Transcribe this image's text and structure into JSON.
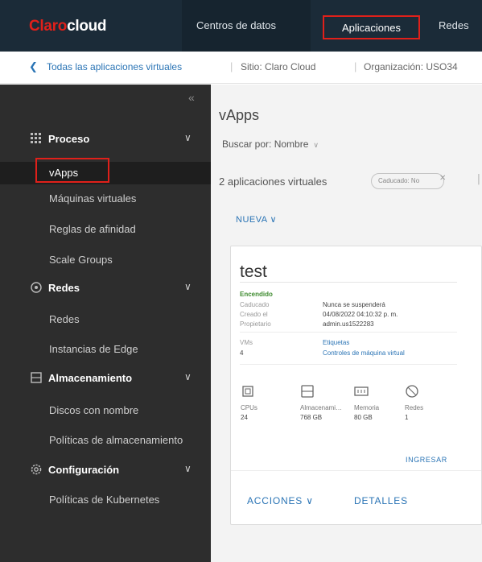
{
  "header": {
    "logo_brand": "Claro",
    "logo_product": "cloud",
    "tabs": [
      {
        "label": "Centros de datos"
      },
      {
        "label": "Aplicaciones"
      },
      {
        "label": "Redes"
      }
    ]
  },
  "breadcrumb": {
    "back_icon": "chevron-left-icon",
    "link": "Todas las aplicaciones virtuales",
    "site": "Sitio: Claro Cloud",
    "org": "Organización: USO34"
  },
  "sidebar": {
    "collapse_icon": "double-chevron-left-icon",
    "sections": [
      {
        "label": "Proceso",
        "icon": "grid-icon",
        "items": [
          "vApps",
          "Máquinas virtuales",
          "Reglas de afinidad",
          "Scale Groups"
        ]
      },
      {
        "label": "Redes",
        "icon": "network-icon",
        "items": [
          "Redes",
          "Instancias de Edge"
        ]
      },
      {
        "label": "Almacenamiento",
        "icon": "storage-icon",
        "items": [
          "Discos con nombre",
          "Políticas de almacenamiento"
        ]
      },
      {
        "label": "Configuración",
        "icon": "gear-icon",
        "items": [
          "Políticas de Kubernetes"
        ]
      }
    ],
    "active_item": "vApps"
  },
  "main": {
    "title": "vApps",
    "search_filter": "Buscar por: Nombre",
    "summary": "2 aplicaciones virtuales",
    "filter_pill": "Caducado: No",
    "new_button": "NUEVA"
  },
  "card": {
    "title": "test",
    "status": "Encendido",
    "details": [
      {
        "label": "Caducado",
        "value": "Nunca se suspenderá"
      },
      {
        "label": "Creado el",
        "value": "04/08/2022 04:10:32 p. m."
      },
      {
        "label": "Propietario",
        "value": "admin.us1522283"
      }
    ],
    "details2": [
      {
        "label": "VMs",
        "value": "Etiquetas"
      },
      {
        "label": "4",
        "value": "Controles de máquina virtual"
      }
    ],
    "resources": [
      {
        "icon": "cpu-icon",
        "label": "CPUs",
        "value": "24"
      },
      {
        "icon": "storage-icon",
        "label": "Almacenamiento",
        "value": "768 GB"
      },
      {
        "icon": "memory-icon",
        "label": "Memoria",
        "value": "80 GB"
      },
      {
        "icon": "network-icon",
        "label": "Redes",
        "value": "1"
      }
    ],
    "ingresar": "INGRESAR",
    "actions": "ACCIONES",
    "details_link": "DETALLES"
  },
  "colors": {
    "accent": "#e0201a",
    "link": "#2a74b5",
    "sidebar_bg": "#2d2d2d",
    "topbar_bg": "#1b2b38"
  }
}
